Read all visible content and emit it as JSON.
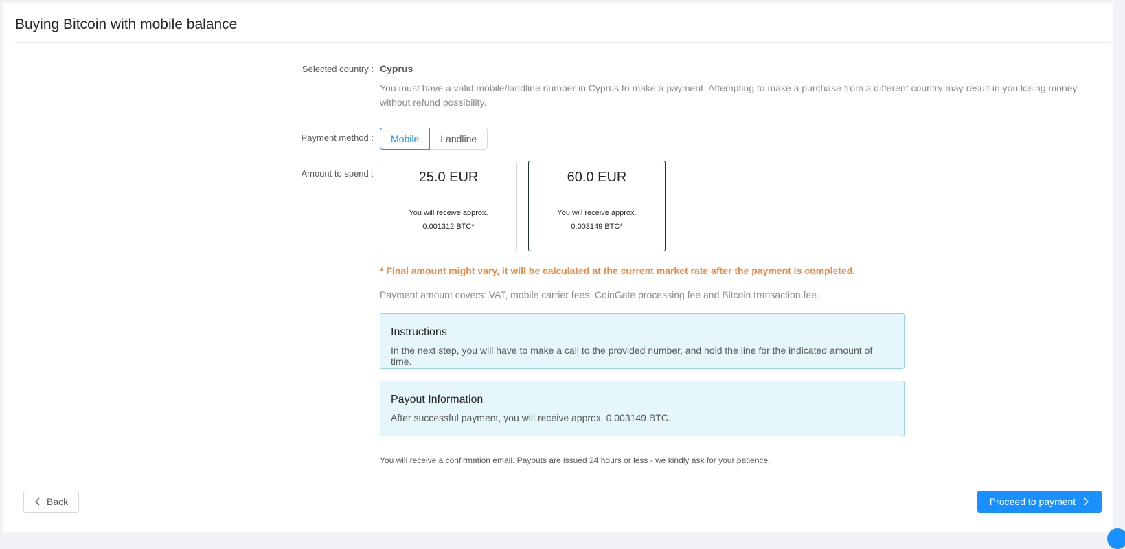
{
  "page": {
    "title": "Buying Bitcoin with mobile balance"
  },
  "form": {
    "country_label": "Selected country",
    "country_value": "Cyprus",
    "country_help": "You must have a valid mobile/landline number in Cyprus to make a payment. Attempting to make a purchase from a different country may result in you losing money without refund possibility.",
    "method_label": "Payment method",
    "methods": [
      "Mobile",
      "Landline"
    ],
    "selected_method": "Mobile",
    "amount_label": "Amount to spend",
    "amounts": [
      {
        "value": "25.0 EUR",
        "receive_line1": "You will receive approx.",
        "receive_line2": "0.001312 BTC*"
      },
      {
        "value": "60.0 EUR",
        "receive_line1": "You will receive approx.",
        "receive_line2": "0.003149 BTC*"
      }
    ],
    "selected_amount": "60.0 EUR"
  },
  "notes": {
    "final_amount": "* Final amount might vary, it will be calculated at the current market rate after the payment is completed.",
    "covers": "Payment amount covers: VAT, mobile carrier fees, CoinGate processing fee and Bitcoin transaction fee.",
    "confirmation": "You will receive a confirmation email. Payouts are issued 24 hours or less - we kindly ask for your patience."
  },
  "instructions": {
    "title": "Instructions",
    "text": "In the next step, you will have to make a call to the provided number, and hold the line for the indicated amount of time."
  },
  "payout": {
    "title": "Payout Information",
    "text": "After successful payment, you will receive approx. 0.003149 BTC."
  },
  "actions": {
    "back_label": "Back",
    "proceed_label": "Proceed to payment"
  },
  "colors": {
    "accent": "#1890ff",
    "warning": "#f5873a",
    "info_bg": "#e6f7fc"
  },
  "icons": {
    "back": "chevron-left-icon",
    "proceed": "chevron-right-icon"
  }
}
